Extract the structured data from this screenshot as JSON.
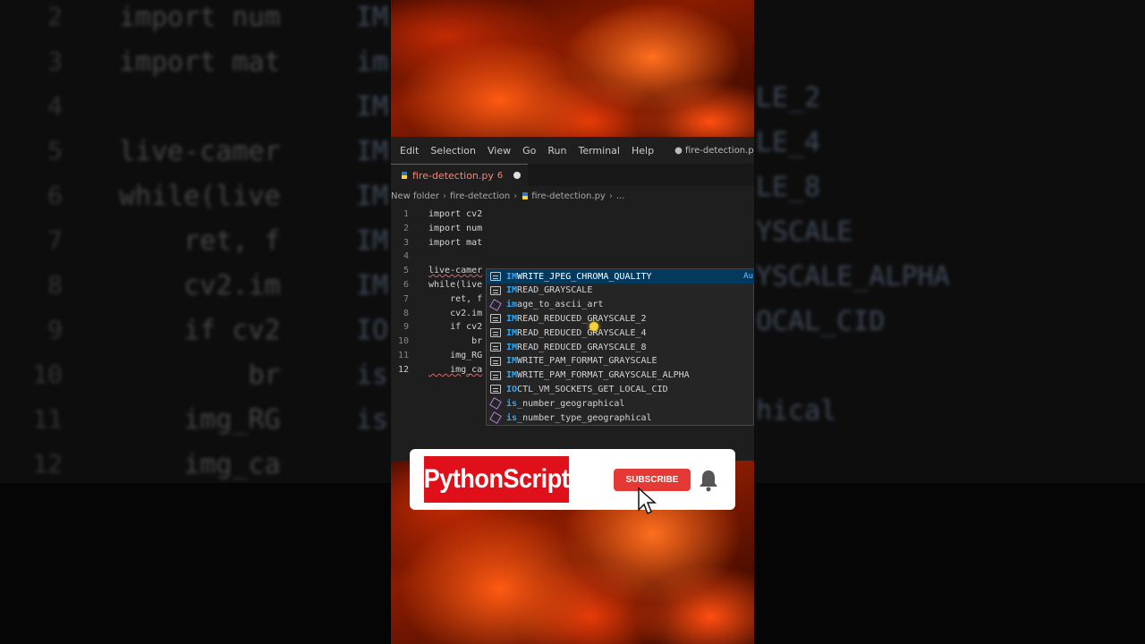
{
  "background": {
    "lines": [
      {
        "num": "2",
        "text": "import num"
      },
      {
        "num": "3",
        "text": "import mat"
      },
      {
        "num": "4",
        "text": ""
      },
      {
        "num": "5",
        "text": "live-camer"
      },
      {
        "num": "6",
        "text": "while(live"
      },
      {
        "num": "7",
        "text": "    ret, f"
      },
      {
        "num": "8",
        "text": "    cv2.im"
      },
      {
        "num": "9",
        "text": "    if cv2"
      },
      {
        "num": "10",
        "text": "        br"
      },
      {
        "num": "11",
        "text": "    img_RG"
      },
      {
        "num": "12",
        "text": "    img_ca"
      }
    ],
    "suggestions_right": [
      "LE_2",
      "LE_4",
      "LE_8",
      "YSCALE",
      "YSCALE_ALPHA",
      "OCAL_CID",
      "hical"
    ],
    "suggestions_left": [
      "IM",
      "im",
      "IM",
      "IM",
      "IM",
      "IM",
      "IM",
      "IO",
      "is",
      "is"
    ]
  },
  "menubar": {
    "items": [
      "Edit",
      "Selection",
      "View",
      "Go",
      "Run",
      "Terminal",
      "Help"
    ],
    "window_title": "● fire-detection.py - visu"
  },
  "tab": {
    "label": "fire-detection.py",
    "badge": "6"
  },
  "breadcrumb": {
    "parts": [
      "New folder",
      "fire-detection",
      "fire-detection.py",
      "..."
    ]
  },
  "editor": {
    "lines": [
      {
        "num": "1",
        "text": "import cv2"
      },
      {
        "num": "2",
        "text": "import num"
      },
      {
        "num": "3",
        "text": "import mat"
      },
      {
        "num": "4",
        "text": ""
      },
      {
        "num": "5",
        "text": "live-camer"
      },
      {
        "num": "6",
        "text": "while(live"
      },
      {
        "num": "7",
        "text": "    ret, f"
      },
      {
        "num": "8",
        "text": "    cv2.im"
      },
      {
        "num": "9",
        "text": "    if cv2"
      },
      {
        "num": "10",
        "text": "        br"
      },
      {
        "num": "11",
        "text": "    img_RG"
      },
      {
        "num": "12",
        "text": "    img_ca"
      }
    ],
    "active_line": "12"
  },
  "suggestions": [
    {
      "kind": "const",
      "prefix": "IM",
      "rest": "WRITE_JPEG_CHROMA_QUALITY",
      "selected": true
    },
    {
      "kind": "const",
      "prefix": "IM",
      "rest": "READ_GRAYSCALE"
    },
    {
      "kind": "func",
      "prefix": "im",
      "rest": "age_to_ascii_art"
    },
    {
      "kind": "const",
      "prefix": "IM",
      "rest": "READ_REDUCED_GRAYSCALE_2"
    },
    {
      "kind": "const",
      "prefix": "IM",
      "rest": "READ_REDUCED_GRAYSCALE_4"
    },
    {
      "kind": "const",
      "prefix": "IM",
      "rest": "READ_REDUCED_GRAYSCALE_8"
    },
    {
      "kind": "const",
      "prefix": "IM",
      "rest": "WRITE_PAM_FORMAT_GRAYSCALE"
    },
    {
      "kind": "const",
      "prefix": "IM",
      "rest": "WRITE_PAM_FORMAT_GRAYSCALE_ALPHA"
    },
    {
      "kind": "const",
      "prefix": "IO",
      "rest": "CTL_VM_SOCKETS_GET_LOCAL_CID"
    },
    {
      "kind": "func",
      "prefix": "is",
      "rest": "_number_geographical"
    },
    {
      "kind": "func",
      "prefix": "is",
      "rest": "_number_type_geographical"
    }
  ],
  "suggestion_hint": "Au",
  "subscribe": {
    "channel_name": "PythonScript",
    "button_label": "SUBSCRIBE"
  },
  "colors": {
    "accent_blue": "#0078d4",
    "subscribe_red": "#e53935",
    "channel_red": "#e0101a",
    "fire_orange": "#ff5a12"
  }
}
